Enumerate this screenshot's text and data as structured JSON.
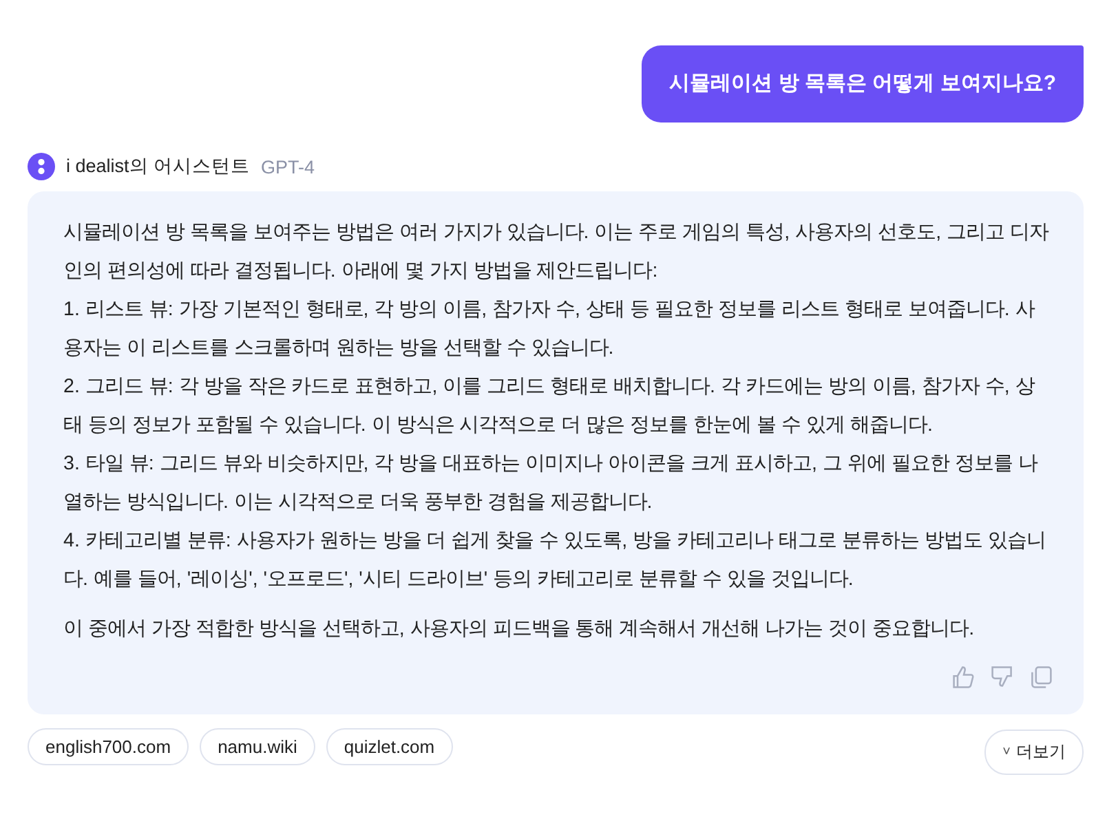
{
  "user_message": "시뮬레이션 방 목록은 어떻게 보여지나요?",
  "assistant": {
    "name": "i dealist의 어시스턴트",
    "model": "GPT-4"
  },
  "answer": {
    "paragraphs": [
      "시뮬레이션 방 목록을 보여주는 방법은 여러 가지가 있습니다. 이는 주로 게임의 특성, 사용자의 선호도, 그리고 디자인의 편의성에 따라 결정됩니다. 아래에 몇 가지 방법을 제안드립니다:",
      "1. 리스트 뷰: 가장 기본적인 형태로, 각 방의 이름, 참가자 수, 상태 등 필요한 정보를 리스트 형태로 보여줍니다. 사용자는 이 리스트를 스크롤하며 원하는 방을 선택할 수 있습니다.",
      "2. 그리드 뷰: 각 방을 작은 카드로 표현하고, 이를 그리드 형태로 배치합니다. 각 카드에는 방의 이름, 참가자 수, 상태 등의 정보가 포함될 수 있습니다. 이 방식은 시각적으로 더 많은 정보를 한눈에 볼 수 있게 해줍니다.",
      "3. 타일 뷰: 그리드 뷰와 비슷하지만, 각 방을 대표하는 이미지나 아이콘을 크게 표시하고, 그 위에 필요한 정보를 나열하는 방식입니다. 이는 시각적으로 더욱 풍부한 경험을 제공합니다.",
      "4. 카테고리별 분류: 사용자가 원하는 방을 더 쉽게 찾을 수 있도록, 방을 카테고리나 태그로 분류하는 방법도 있습니다. 예를 들어, '레이싱', '오프로드', '시티 드라이브' 등의 카테고리로 분류할 수 있을 것입니다."
    ],
    "conclusion": "이 중에서 가장 적합한 방식을 선택하고, 사용자의 피드백을 통해 계속해서 개선해 나가는 것이 중요합니다."
  },
  "sources": [
    "english700.com",
    "namu.wiki",
    "quizlet.com"
  ],
  "more_button": {
    "icon": "˅",
    "label": "더보기"
  }
}
